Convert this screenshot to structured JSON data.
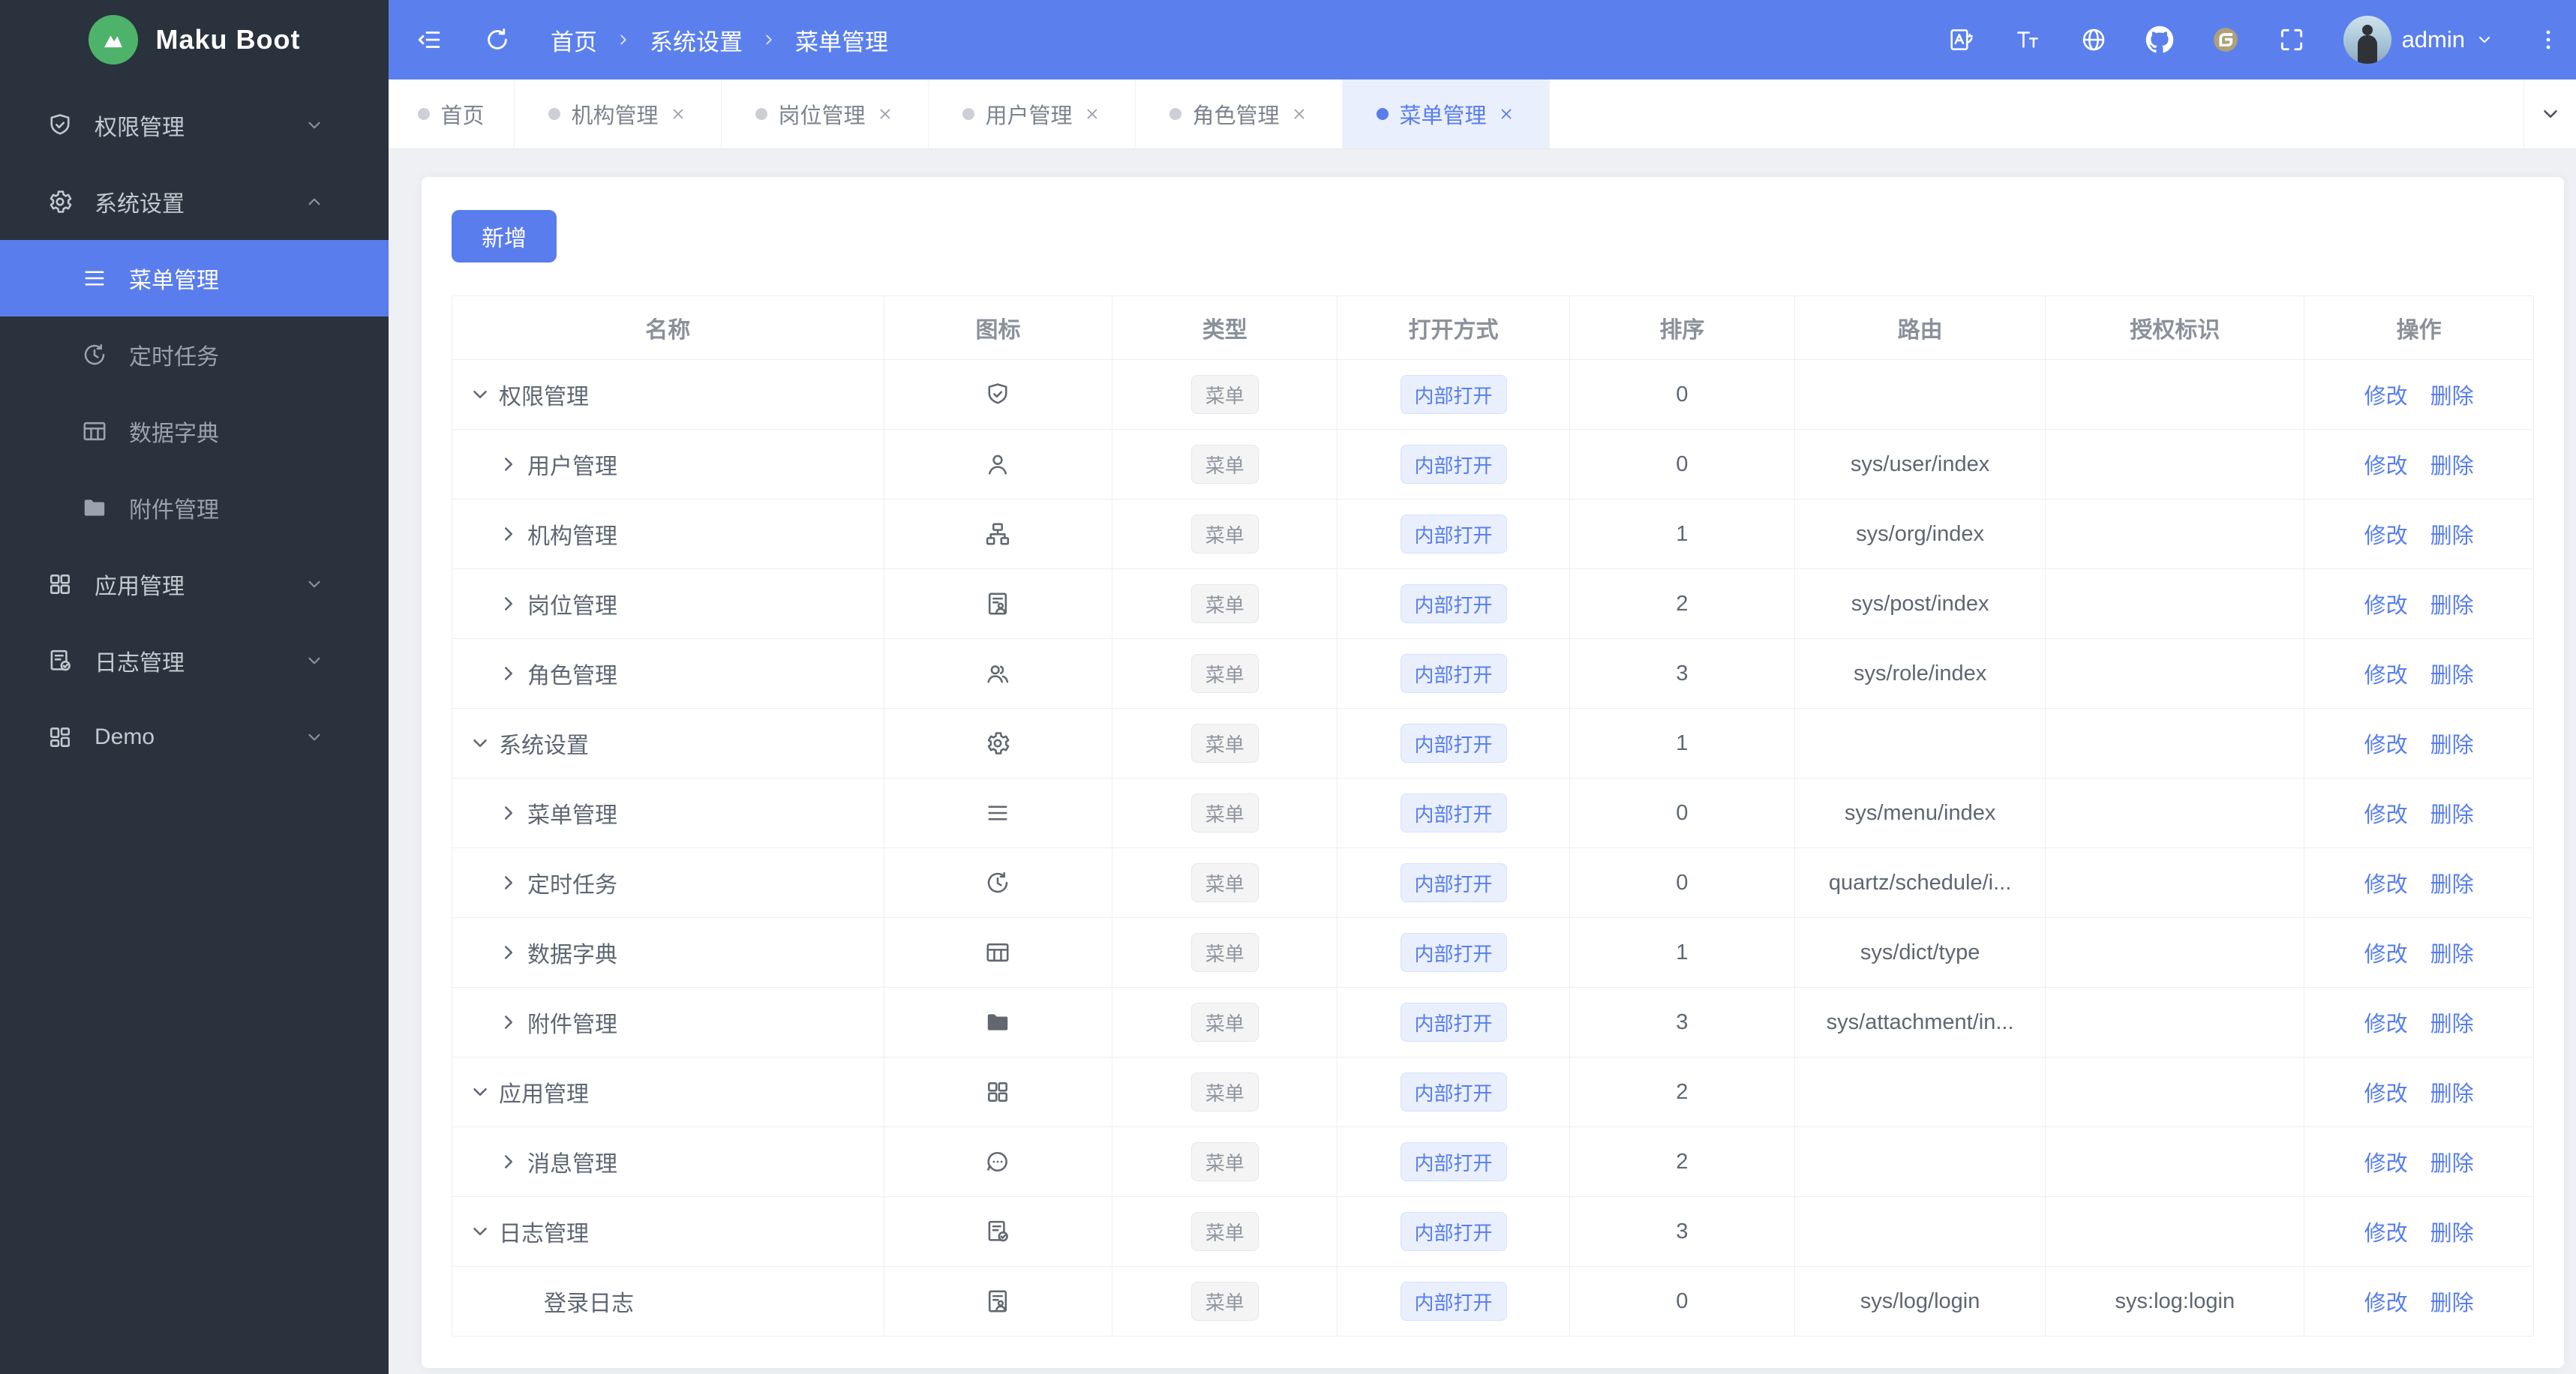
{
  "colors": {
    "primary": "#5a7ded",
    "sidebar_bg": "#2a333d",
    "header_bg": "#5b80ee",
    "page_bg": "#eef0f4",
    "active_tab_bg": "#e9effc",
    "tag_info_bg": "#f4f4f5",
    "tag_info_text": "#90959e",
    "tag_primary_bg": "#e9effd",
    "tag_primary_text": "#567dee",
    "logo_green": "#4db36b",
    "gitee_gold": "#aea177"
  },
  "sidebar": {
    "logo_text": "Maku Boot",
    "items": [
      {
        "id": "permission",
        "label": "权限管理",
        "icon": "shield-check-icon",
        "state": "collapsed"
      },
      {
        "id": "system",
        "label": "系统设置",
        "icon": "gear-icon",
        "state": "expanded",
        "children": [
          {
            "id": "menu",
            "label": "菜单管理",
            "icon": "menu-icon",
            "active": true
          },
          {
            "id": "schedule",
            "label": "定时任务",
            "icon": "clock-icon",
            "active": false
          },
          {
            "id": "dict",
            "label": "数据字典",
            "icon": "dict-table-icon",
            "active": false
          },
          {
            "id": "attachment",
            "label": "附件管理",
            "icon": "folder-icon",
            "active": false
          }
        ]
      },
      {
        "id": "app",
        "label": "应用管理",
        "icon": "app-grid-icon",
        "state": "collapsed"
      },
      {
        "id": "log",
        "label": "日志管理",
        "icon": "log-doc-icon",
        "state": "collapsed"
      },
      {
        "id": "demo",
        "label": "Demo",
        "icon": "demo-grid-icon",
        "state": "collapsed"
      }
    ]
  },
  "header": {
    "breadcrumb": [
      "首页",
      "系统设置",
      "菜单管理"
    ],
    "right_icons": [
      "translate-icon",
      "font-size-icon",
      "globe-icon",
      "github-icon",
      "gitee-icon",
      "fullscreen-icon"
    ],
    "user": {
      "name": "admin"
    }
  },
  "tabs": [
    {
      "label": "首页",
      "closable": false,
      "active": false
    },
    {
      "label": "机构管理",
      "closable": true,
      "active": false
    },
    {
      "label": "岗位管理",
      "closable": true,
      "active": false
    },
    {
      "label": "用户管理",
      "closable": true,
      "active": false
    },
    {
      "label": "角色管理",
      "closable": true,
      "active": false
    },
    {
      "label": "菜单管理",
      "closable": true,
      "active": true
    }
  ],
  "toolbar": {
    "add_label": "新增"
  },
  "table": {
    "columns": [
      "名称",
      "图标",
      "类型",
      "打开方式",
      "排序",
      "路由",
      "授权标识",
      "操作"
    ],
    "actions": {
      "edit": "修改",
      "delete": "删除"
    },
    "rows": [
      {
        "name": "权限管理",
        "level": 0,
        "expander": "down",
        "icon": "shield-check-icon",
        "type": "菜单",
        "open": "内部打开",
        "sort": "0",
        "route": "",
        "perm": ""
      },
      {
        "name": "用户管理",
        "level": 1,
        "expander": "right",
        "icon": "user-icon",
        "type": "菜单",
        "open": "内部打开",
        "sort": "0",
        "route": "sys/user/index",
        "perm": ""
      },
      {
        "name": "机构管理",
        "level": 1,
        "expander": "right",
        "icon": "org-icon",
        "type": "菜单",
        "open": "内部打开",
        "sort": "1",
        "route": "sys/org/index",
        "perm": ""
      },
      {
        "name": "岗位管理",
        "level": 1,
        "expander": "right",
        "icon": "doc-user-icon",
        "type": "菜单",
        "open": "内部打开",
        "sort": "2",
        "route": "sys/post/index",
        "perm": ""
      },
      {
        "name": "角色管理",
        "level": 1,
        "expander": "right",
        "icon": "users-icon",
        "type": "菜单",
        "open": "内部打开",
        "sort": "3",
        "route": "sys/role/index",
        "perm": ""
      },
      {
        "name": "系统设置",
        "level": 0,
        "expander": "down",
        "icon": "gear-icon",
        "type": "菜单",
        "open": "内部打开",
        "sort": "1",
        "route": "",
        "perm": ""
      },
      {
        "name": "菜单管理",
        "level": 1,
        "expander": "right",
        "icon": "menu-icon",
        "type": "菜单",
        "open": "内部打开",
        "sort": "0",
        "route": "sys/menu/index",
        "perm": ""
      },
      {
        "name": "定时任务",
        "level": 1,
        "expander": "right",
        "icon": "clock-icon",
        "type": "菜单",
        "open": "内部打开",
        "sort": "0",
        "route": "quartz/schedule/i...",
        "perm": ""
      },
      {
        "name": "数据字典",
        "level": 1,
        "expander": "right",
        "icon": "dict-table-icon",
        "type": "菜单",
        "open": "内部打开",
        "sort": "1",
        "route": "sys/dict/type",
        "perm": ""
      },
      {
        "name": "附件管理",
        "level": 1,
        "expander": "right",
        "icon": "folder-icon",
        "type": "菜单",
        "open": "内部打开",
        "sort": "3",
        "route": "sys/attachment/in...",
        "perm": ""
      },
      {
        "name": "应用管理",
        "level": 0,
        "expander": "down",
        "icon": "app-grid-icon",
        "type": "菜单",
        "open": "内部打开",
        "sort": "2",
        "route": "",
        "perm": ""
      },
      {
        "name": "消息管理",
        "level": 1,
        "expander": "right",
        "icon": "chat-icon",
        "type": "菜单",
        "open": "内部打开",
        "sort": "2",
        "route": "",
        "perm": ""
      },
      {
        "name": "日志管理",
        "level": 0,
        "expander": "down",
        "icon": "log-doc-icon",
        "type": "菜单",
        "open": "内部打开",
        "sort": "3",
        "route": "",
        "perm": ""
      },
      {
        "name": "登录日志",
        "level": 1,
        "expander": "none",
        "icon": "doc-user-icon",
        "type": "菜单",
        "open": "内部打开",
        "sort": "0",
        "route": "sys/log/login",
        "perm": "sys:log:login"
      }
    ]
  }
}
